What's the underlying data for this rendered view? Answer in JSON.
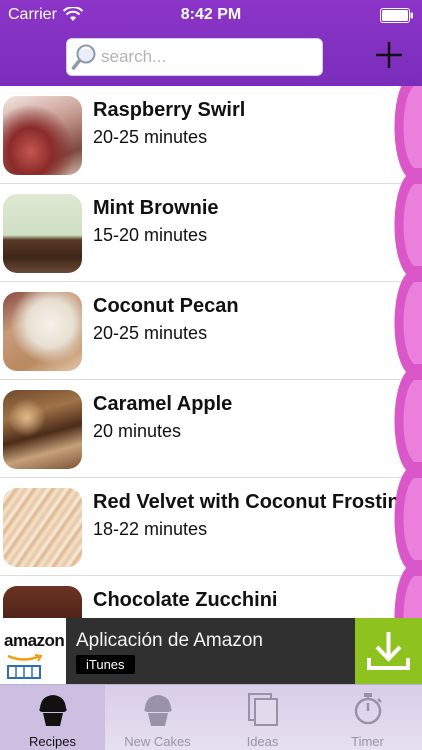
{
  "status_bar": {
    "carrier": "Carrier",
    "time": "8:42 PM"
  },
  "search": {
    "placeholder": "search..."
  },
  "recipes": [
    {
      "name": "Raspberry Swirl",
      "time": "20-25 minutes"
    },
    {
      "name": "Mint Brownie",
      "time": "15-20 minutes"
    },
    {
      "name": "Coconut Pecan",
      "time": "20-25 minutes"
    },
    {
      "name": "Caramel Apple",
      "time": "20 minutes"
    },
    {
      "name": "Red Velvet with Coconut Frosting",
      "time": "18-22 minutes"
    },
    {
      "name": "Chocolate Zucchini",
      "time": ""
    }
  ],
  "ad": {
    "brand": "amazon",
    "title": "Aplicación de Amazon",
    "badge": "iTunes"
  },
  "tabs": [
    {
      "label": "Recipes",
      "icon": "cupcake-icon",
      "active": true
    },
    {
      "label": "New Cakes",
      "icon": "cupcake-icon",
      "active": false
    },
    {
      "label": "Ideas",
      "icon": "pages-icon",
      "active": false
    },
    {
      "label": "Timer",
      "icon": "stopwatch-icon",
      "active": false
    }
  ],
  "colors": {
    "header": "#8c35c8",
    "scallop": "#d957c8",
    "ad_download": "#8dc21f"
  }
}
